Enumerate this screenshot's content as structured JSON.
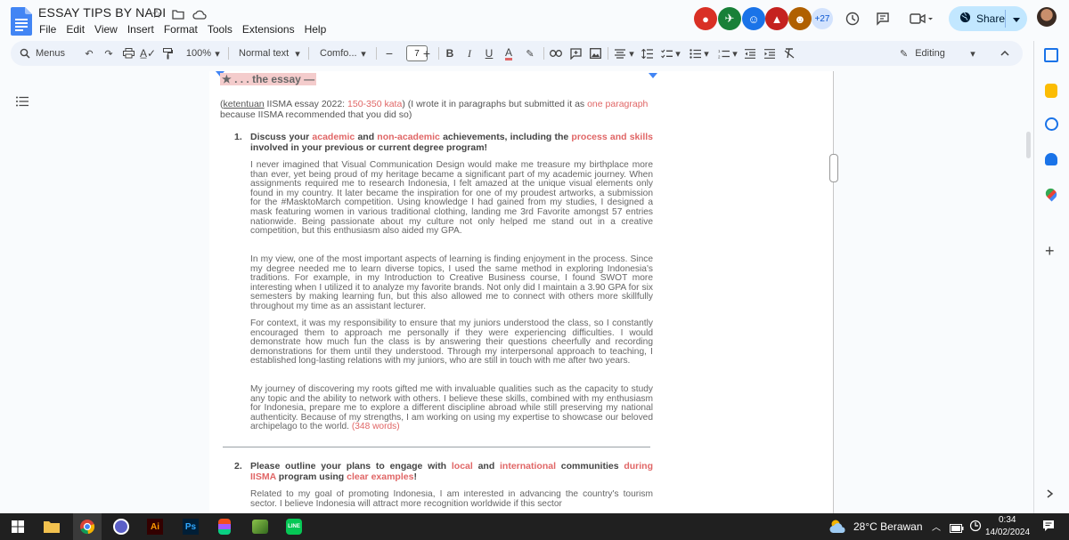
{
  "doc": {
    "title": "ESSAY TIPS BY NADI",
    "menu": [
      "File",
      "Edit",
      "View",
      "Insert",
      "Format",
      "Tools",
      "Extensions",
      "Help"
    ],
    "collaborators_more": "+27",
    "share_label": "Share"
  },
  "toolbar": {
    "menus_label": "Menus",
    "zoom": "100%",
    "style": "Normal text",
    "font": "Comfo...",
    "font_size": "7",
    "mode": "Editing"
  },
  "content": {
    "heading_fragment": "★ . . .  the essay —",
    "intro": {
      "p1": "(",
      "ketentuan": "ketentuan",
      "p2": " IISMA essay 2022: ",
      "word_range": "150-350 kata",
      "p3": ") (I wrote it in paragraphs but submitted it as ",
      "one_paragraph": "one paragraph",
      "p4": " because IISMA recommended that you did so)"
    },
    "q1": {
      "number": "1.",
      "t1": "Discuss your ",
      "academic": "academic",
      "t2": " and ",
      "non_academic": "non-academic",
      "t3": " achievements, including the ",
      "process": "process and skills",
      "t4": " involved in your previous or current degree program!"
    },
    "paragraphs": [
      "I never imagined that Visual Communication Design would make me treasure my birthplace more than ever, yet being proud of my heritage became a significant part of my academic journey. When assignments required me to research Indonesia, I felt amazed at the unique visual elements only found in my country. It later became the inspiration for one of my proudest artworks, a submission for the #MasktoMarch competition. Using knowledge I had gained from my studies, I designed a mask featuring women in various traditional clothing, landing me 3rd Favorite amongst 57 entries nationwide. Being passionate about my culture not only helped me stand out in a creative competition, but this enthusiasm also aided my GPA.",
      "In my view, one of the most important aspects of learning is finding enjoyment in the process. Since my degree needed me to learn diverse topics, I used the same method in exploring Indonesia's traditions. For example, in my Introduction to Creative Business course, I found SWOT more interesting when I utilized it to analyze my favorite brands. Not only did I maintain a 3.90 GPA for six semesters by making learning fun, but this also allowed me to connect with others more skillfully throughout my time as an assistant lecturer.",
      "For context, it was my responsibility to ensure that my juniors understood the class, so I constantly encouraged them to approach me personally if they were experiencing difficulties. I would demonstrate how much fun the class is by answering their questions cheerfully and recording demonstrations for them until they understood. Through my interpersonal approach to teaching, I established long-lasting relations with my juniors, who are still in touch with me after two years.",
      "My journey of discovering my roots gifted me with invaluable qualities such as the capacity to study any topic and the ability to network with others. I believe these skills, combined with my enthusiasm for Indonesia, prepare me to explore a different discipline abroad while still preserving my national authenticity. Because of my strengths, I am working on using my expertise to showcase our beloved archipelago to the world."
    ],
    "word_count": "(348 words)",
    "q2": {
      "number": "2.",
      "t1": "Please outline your plans to engage with ",
      "local": "local",
      "t2": " and ",
      "international": "international",
      "t3": " communities ",
      "during": "during IISMA",
      "t4": " program using ",
      "clear": "clear examples",
      "t5": "!"
    },
    "q2_paragraph": "Related to my goal of promoting Indonesia, I am interested in advancing the country's tourism sector. I believe Indonesia will attract more recognition worldwide if this sector"
  },
  "taskbar": {
    "weather": "28°C  Berawan",
    "time": "0:34",
    "date": "14/02/2024"
  },
  "colors": {
    "accent_red": "#e06666",
    "share_bg": "#c2e7ff",
    "highlight": "#f4cccc"
  }
}
